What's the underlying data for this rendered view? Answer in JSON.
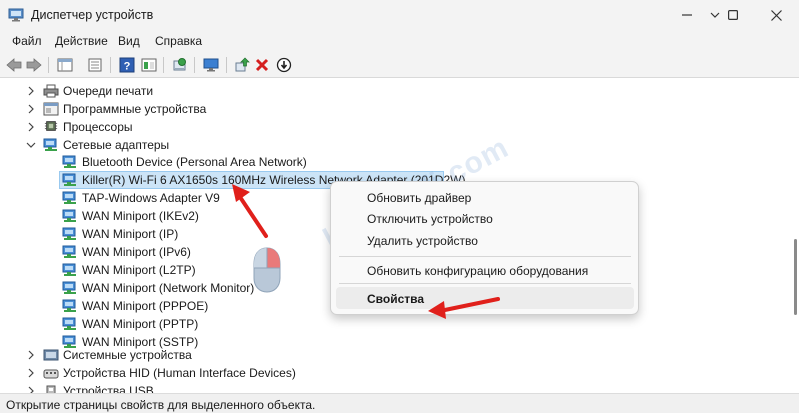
{
  "window": {
    "title": "Диспетчер устройств",
    "controls": [
      "chevron-down-icon",
      "minimize-icon",
      "maximize-icon",
      "close-icon"
    ]
  },
  "menu": [
    {
      "label": "Файл"
    },
    {
      "label": "Действие"
    },
    {
      "label": "Вид"
    },
    {
      "label": "Справка"
    }
  ],
  "toolbar": {
    "buttons": [
      "back-icon",
      "forward-icon",
      "properties-grid-icon",
      "properties-icon",
      "help-icon",
      "view-icon",
      "scan-hardware-icon",
      "monitor-icon",
      "update-driver-icon",
      "remove-device-icon",
      "disable-device-icon"
    ]
  },
  "tree": {
    "categories_top": [
      {
        "label": "Очереди печати",
        "expanded": false
      },
      {
        "label": "Программные устройства",
        "expanded": false
      },
      {
        "label": "Процессоры",
        "expanded": false
      },
      {
        "label": "Сетевые адаптеры",
        "expanded": true
      }
    ],
    "adapters": [
      {
        "label": "Bluetooth Device (Personal Area Network)"
      },
      {
        "label": "Killer(R) Wi-Fi 6 AX1650s 160MHz Wireless Network Adapter (201D2W)",
        "selected": true
      },
      {
        "label": "TAP-Windows Adapter V9"
      },
      {
        "label": "WAN Miniport (IKEv2)"
      },
      {
        "label": "WAN Miniport (IP)"
      },
      {
        "label": "WAN Miniport (IPv6)"
      },
      {
        "label": "WAN Miniport (L2TP)"
      },
      {
        "label": "WAN Miniport (Network Monitor)"
      },
      {
        "label": "WAN Miniport (PPPOE)"
      },
      {
        "label": "WAN Miniport (PPTP)"
      },
      {
        "label": "WAN Miniport (SSTP)"
      }
    ],
    "categories_bottom": [
      {
        "label": "Системные устройства",
        "expanded": false
      },
      {
        "label": "Устройства HID (Human Interface Devices)",
        "expanded": false
      },
      {
        "label": "Устройства USB",
        "expanded": false
      }
    ]
  },
  "context_menu": {
    "items": [
      {
        "label": "Обновить драйвер"
      },
      {
        "label": "Отключить устройство"
      },
      {
        "label": "Удалить устройство"
      },
      {
        "label": "Обновить конфигурацию оборудования"
      },
      {
        "label": "Свойства",
        "bold": true
      }
    ]
  },
  "status": {
    "text": "Открытие страницы свойств для выделенного объекта."
  },
  "watermark": "help-wifi.com",
  "colors": {
    "selection": "#cce4f7",
    "arrow": "#e0201b",
    "icon_blue": "#2b7fc7",
    "icon_green": "#3aa14b"
  }
}
